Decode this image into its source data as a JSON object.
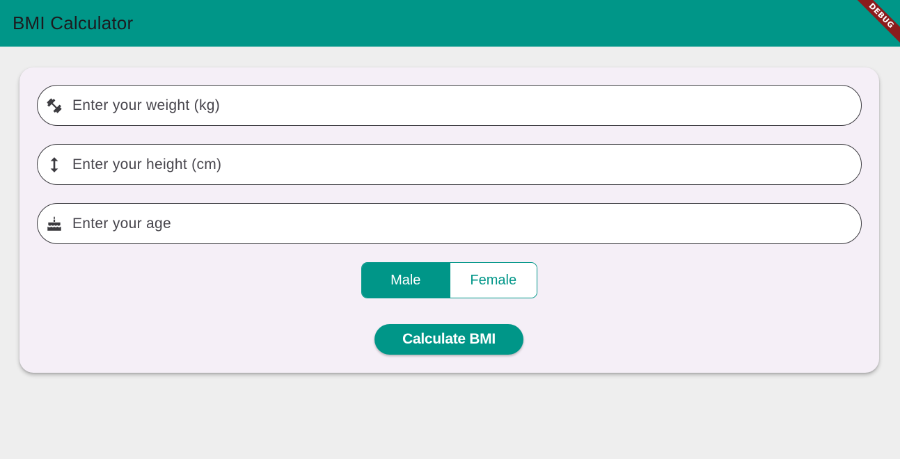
{
  "app": {
    "title": "BMI Calculator",
    "debug_label": "DEBUG",
    "accent_color": "#009688"
  },
  "form": {
    "weight": {
      "placeholder": "Enter your weight (kg)",
      "value": "",
      "icon": "fitness-center-icon"
    },
    "height": {
      "placeholder": "Enter your height (cm)",
      "value": "",
      "icon": "height-icon"
    },
    "age": {
      "placeholder": "Enter your age",
      "value": "",
      "icon": "cake-icon"
    }
  },
  "gender": {
    "options": [
      "Male",
      "Female"
    ],
    "selected": "Male"
  },
  "actions": {
    "calculate_label": "Calculate BMI"
  }
}
